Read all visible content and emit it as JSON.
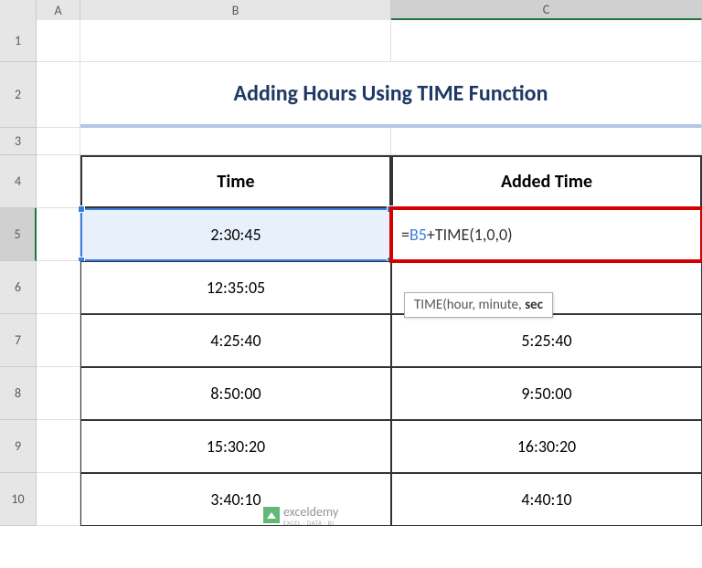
{
  "cols": {
    "A": "A",
    "B": "B",
    "C": "C"
  },
  "rows": [
    "1",
    "2",
    "3",
    "4",
    "5",
    "6",
    "7",
    "8",
    "9",
    "10"
  ],
  "title": "Adding Hours Using TIME Function",
  "headers": {
    "time": "Time",
    "added": "Added Time"
  },
  "data": [
    {
      "time": "2:30:45",
      "added": ""
    },
    {
      "time": "12:35:05",
      "added": ""
    },
    {
      "time": "4:25:40",
      "added": "5:25:40"
    },
    {
      "time": "8:50:00",
      "added": "9:50:00"
    },
    {
      "time": "15:30:20",
      "added": "16:30:20"
    },
    {
      "time": "3:40:10",
      "added": "4:40:10"
    }
  ],
  "formula": {
    "prefix": "=",
    "ref": "B5",
    "suffix": "+TIME(1,0,0)"
  },
  "tooltip": {
    "pre": "TIME(hour, minute, ",
    "bold": "sec"
  },
  "watermark": {
    "brand": "exceldemy",
    "tag": "EXCEL · DATA · BI"
  },
  "chart_data": {
    "type": "table",
    "columns": [
      "Time",
      "Added Time"
    ],
    "rows": [
      [
        "2:30:45",
        "=B5+TIME(1,0,0)"
      ],
      [
        "12:35:05",
        ""
      ],
      [
        "4:25:40",
        "5:25:40"
      ],
      [
        "8:50:00",
        "9:50:00"
      ],
      [
        "15:30:20",
        "16:30:20"
      ],
      [
        "3:40:10",
        "4:40:10"
      ]
    ],
    "title": "Adding Hours Using TIME Function"
  }
}
